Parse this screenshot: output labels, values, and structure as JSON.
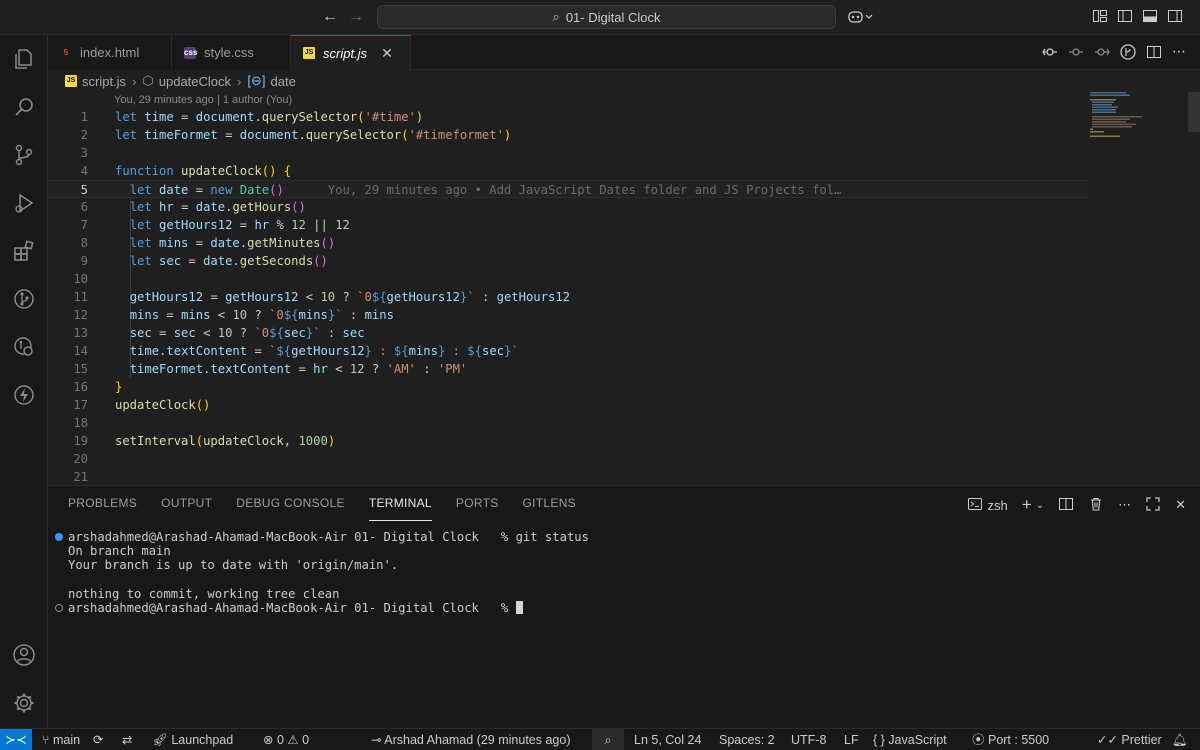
{
  "window": {
    "title": "01- Digital Clock"
  },
  "tabs": [
    {
      "label": "index.html",
      "icon": "html-file-icon"
    },
    {
      "label": "style.css",
      "icon": "css-file-icon"
    },
    {
      "label": "script.js",
      "icon": "js-file-icon",
      "active": true
    }
  ],
  "breadcrumb": {
    "file": "script.js",
    "function": "updateClock",
    "symbol": "date"
  },
  "editor": {
    "blame_header": "You, 29 minutes ago | 1 author (You)",
    "inline_blame": "You, 29 minutes ago • Add JavaScript Dates folder and JS Projects fol…",
    "current_line": 5,
    "line_numbers": [
      "1",
      "2",
      "3",
      "4",
      "5",
      "6",
      "7",
      "8",
      "9",
      "10",
      "11",
      "12",
      "13",
      "14",
      "15",
      "16",
      "17",
      "18",
      "19",
      "20",
      "21"
    ]
  },
  "panel": {
    "tabs": [
      "PROBLEMS",
      "OUTPUT",
      "DEBUG CONSOLE",
      "TERMINAL",
      "PORTS",
      "GITLENS"
    ],
    "active_tab": "TERMINAL",
    "shell": "zsh",
    "terminal": {
      "prompt1": "arshadahmed@Arashad-Ahamad-MacBook-Air 01- Digital Clock   % git status",
      "out1": "On branch main",
      "out2": "Your branch is up to date with 'origin/main'.",
      "out3": "",
      "out4": "nothing to commit, working tree clean",
      "prompt2": "arshadahmed@Arashad-Ahamad-MacBook-Air 01- Digital Clock   % "
    }
  },
  "statusbar": {
    "branch": "main",
    "launchpad": "Launchpad",
    "errors": "0",
    "warnings": "0",
    "blame": "Arshad Ahamad (29 minutes ago)",
    "position": "Ln 5, Col 24",
    "spaces": "Spaces: 2",
    "encoding": "UTF-8",
    "eol": "LF",
    "language": "JavaScript",
    "port": "Port : 5500",
    "formatter": "Prettier"
  },
  "colors": {
    "accent": "#0078d4",
    "background": "#1f1f1f",
    "keyword": "#569cd6",
    "string": "#ce9178",
    "function": "#dcdcaa",
    "variable": "#9cdcfe"
  }
}
